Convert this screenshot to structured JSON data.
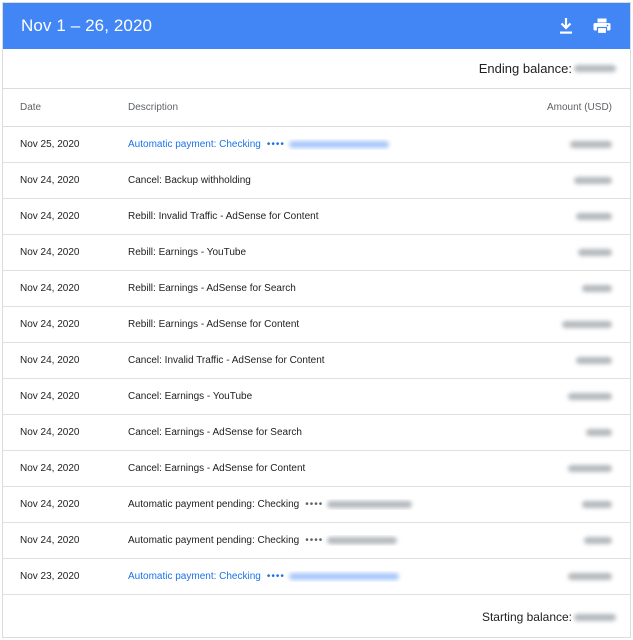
{
  "header": {
    "title": "Nov 1 – 26, 2020",
    "download_icon": "download-icon",
    "print_icon": "print-icon",
    "color": "#4285f4"
  },
  "ending_balance_label": "Ending balance:",
  "columns": {
    "date": "Date",
    "description": "Description",
    "amount": "Amount (USD)"
  },
  "rows": [
    {
      "date": "Nov 25, 2020",
      "description": "Automatic payment: Checking",
      "link": true
    },
    {
      "date": "Nov 24, 2020",
      "description": "Cancel: Backup withholding",
      "link": false
    },
    {
      "date": "Nov 24, 2020",
      "description": "Rebill: Invalid Traffic - AdSense for Content",
      "link": false
    },
    {
      "date": "Nov 24, 2020",
      "description": "Rebill: Earnings - YouTube",
      "link": false
    },
    {
      "date": "Nov 24, 2020",
      "description": "Rebill: Earnings - AdSense for Search",
      "link": false
    },
    {
      "date": "Nov 24, 2020",
      "description": "Rebill: Earnings - AdSense for Content",
      "link": false
    },
    {
      "date": "Nov 24, 2020",
      "description": "Cancel: Invalid Traffic - AdSense for Content",
      "link": false
    },
    {
      "date": "Nov 24, 2020",
      "description": "Cancel: Earnings - YouTube",
      "link": false
    },
    {
      "date": "Nov 24, 2020",
      "description": "Cancel: Earnings - AdSense for Search",
      "link": false
    },
    {
      "date": "Nov 24, 2020",
      "description": "Cancel: Earnings - AdSense for Content",
      "link": false
    },
    {
      "date": "Nov 24, 2020",
      "description": "Automatic payment pending: Checking",
      "link": false
    },
    {
      "date": "Nov 24, 2020",
      "description": "Automatic payment pending: Checking",
      "link": false
    },
    {
      "date": "Nov 23, 2020",
      "description": "Automatic payment: Checking",
      "link": true
    }
  ],
  "starting_balance_label": "Starting balance:"
}
